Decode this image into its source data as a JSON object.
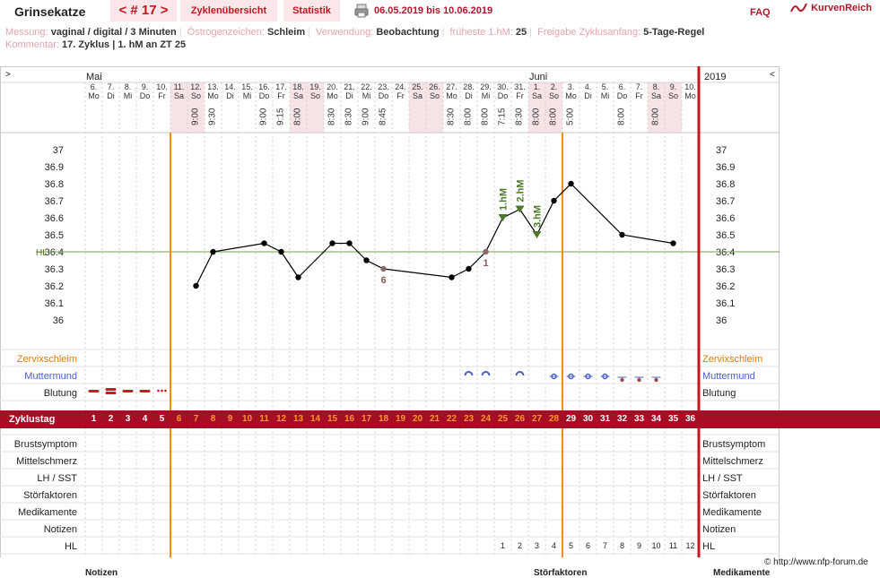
{
  "app": {
    "user": "Grinsekatze",
    "cycle_nav": {
      "prev": "<",
      "label": "# 17",
      "next": ">"
    },
    "tabs": [
      "Zyklenübersicht",
      "Statistik"
    ],
    "date_range": "06.05.2019 bis 10.06.2019",
    "faq": "FAQ",
    "logo": "KurvenReich"
  },
  "info": {
    "messung_label": "Messung:",
    "messung": "vaginal / digital / 3 Minuten",
    "oestrogen_label": "Östrogenzeichen:",
    "oestrogen": "Schleim",
    "verwendung_label": "Verwendung:",
    "verwendung": "Beobachtung",
    "frueheste_label": "früheste 1.hM:",
    "frueheste": "25",
    "freigabe_label": "Freigabe Zyklusanfang:",
    "freigabe": "5-Tage-Regel",
    "kommentar_label": "Kommentar:",
    "kommentar": "17. Zyklus | 1. hM an ZT 25"
  },
  "header": {
    "collapse_left": ">",
    "collapse_right": "<",
    "month_may": "Mai",
    "month_june": "Juni",
    "year": "2019",
    "days": [
      {
        "d": "6.",
        "w": "Mo"
      },
      {
        "d": "7.",
        "w": "Di"
      },
      {
        "d": "8.",
        "w": "Mi"
      },
      {
        "d": "9.",
        "w": "Do"
      },
      {
        "d": "10.",
        "w": "Fr"
      },
      {
        "d": "11.",
        "w": "Sa"
      },
      {
        "d": "12.",
        "w": "So"
      },
      {
        "d": "13.",
        "w": "Mo"
      },
      {
        "d": "14.",
        "w": "Di"
      },
      {
        "d": "15.",
        "w": "Mi"
      },
      {
        "d": "16.",
        "w": "Do"
      },
      {
        "d": "17.",
        "w": "Fr"
      },
      {
        "d": "18.",
        "w": "Sa"
      },
      {
        "d": "19.",
        "w": "So"
      },
      {
        "d": "20.",
        "w": "Mo"
      },
      {
        "d": "21.",
        "w": "Di"
      },
      {
        "d": "22.",
        "w": "Mi"
      },
      {
        "d": "23.",
        "w": "Do"
      },
      {
        "d": "24.",
        "w": "Fr"
      },
      {
        "d": "25.",
        "w": "Sa"
      },
      {
        "d": "26.",
        "w": "So"
      },
      {
        "d": "27.",
        "w": "Mo"
      },
      {
        "d": "28.",
        "w": "Di"
      },
      {
        "d": "29.",
        "w": "Mi"
      },
      {
        "d": "30.",
        "w": "Do"
      },
      {
        "d": "31.",
        "w": "Fr"
      },
      {
        "d": "1.",
        "w": "Sa"
      },
      {
        "d": "2.",
        "w": "So"
      },
      {
        "d": "3.",
        "w": "Mo"
      },
      {
        "d": "4.",
        "w": "Di"
      },
      {
        "d": "5.",
        "w": "Mi"
      },
      {
        "d": "6.",
        "w": "Do"
      },
      {
        "d": "7.",
        "w": "Fr"
      },
      {
        "d": "8.",
        "w": "Sa"
      },
      {
        "d": "9.",
        "w": "So"
      },
      {
        "d": "10.",
        "w": "Mo"
      }
    ],
    "times": [
      "",
      "",
      "",
      "",
      "",
      "",
      "9:00",
      "9:30",
      "",
      "",
      "9:00",
      "9:15",
      "8:00",
      "",
      "8:30",
      "8:30",
      "9:00",
      "8:45",
      "",
      "",
      "",
      "8:30",
      "8:00",
      "8:00",
      "7:15",
      "8:30",
      "8:00",
      "8:00",
      "5:00",
      "",
      "",
      "8:00",
      "",
      "8:00",
      "",
      ""
    ]
  },
  "chart_data": {
    "type": "line",
    "x": [
      7,
      8,
      11,
      12,
      13,
      15,
      16,
      17,
      18,
      22,
      23,
      24,
      25,
      26,
      27,
      28,
      29,
      32,
      35
    ],
    "y": [
      36.2,
      36.4,
      36.45,
      36.4,
      36.25,
      36.45,
      36.45,
      36.35,
      36.3,
      36.25,
      36.3,
      36.4,
      36.6,
      36.65,
      36.5,
      36.7,
      36.8,
      36.5,
      36.45
    ],
    "ylim": [
      36.0,
      37.0
    ],
    "yticks": [
      "37",
      "36.9",
      "36.8",
      "36.7",
      "36.6",
      "36.5",
      "36.4",
      "36.3",
      "36.2",
      "36.1",
      "36"
    ],
    "hl_label": "HL",
    "hl_value": 36.4,
    "low_numbers": [
      {
        "cycle_day": 18,
        "label": "6"
      },
      {
        "cycle_day": 24,
        "label": "1"
      }
    ],
    "high_labels": [
      {
        "cycle_day": 25,
        "label": "1.hM"
      },
      {
        "cycle_day": 26,
        "label": "2.hM"
      },
      {
        "cycle_day": 27,
        "label": "3.hM"
      }
    ],
    "orange_lines_after_cycle_day": [
      5,
      28
    ],
    "colors": {
      "curve": "#000000",
      "hl_line": "#7a9a4a",
      "orange": "#f08c1c",
      "red": "#c8151c",
      "hm": "#4a7a2a",
      "low": "#8a5a5a"
    }
  },
  "rows": {
    "zervix": "Zervixschleim",
    "muttermund": "Muttermund",
    "blutung": "Blutung",
    "zyklustag": "Zyklustag",
    "brust": "Brustsymptom",
    "mittel": "Mittelschmerz",
    "lh": "LH / SST",
    "stoer": "Störfaktoren",
    "medi": "Medikamente",
    "notizen": "Notizen",
    "hl": "HL"
  },
  "cycle_days": [
    "1",
    "2",
    "3",
    "4",
    "5",
    "6",
    "7",
    "8",
    "9",
    "10",
    "11",
    "12",
    "13",
    "14",
    "15",
    "16",
    "17",
    "18",
    "19",
    "20",
    "21",
    "22",
    "23",
    "24",
    "25",
    "26",
    "27",
    "28",
    "29",
    "30",
    "31",
    "32",
    "33",
    "34",
    "35",
    "36"
  ],
  "hl_numbers": [
    "1",
    "2",
    "3",
    "4",
    "5",
    "6",
    "7",
    "8",
    "9",
    "10",
    "11",
    "12"
  ],
  "footer": {
    "copyright": "© http://www.nfp-forum.de",
    "notizen": "Notizen",
    "stoerfaktoren": "Störfaktoren",
    "medikamente": "Medikamente"
  }
}
